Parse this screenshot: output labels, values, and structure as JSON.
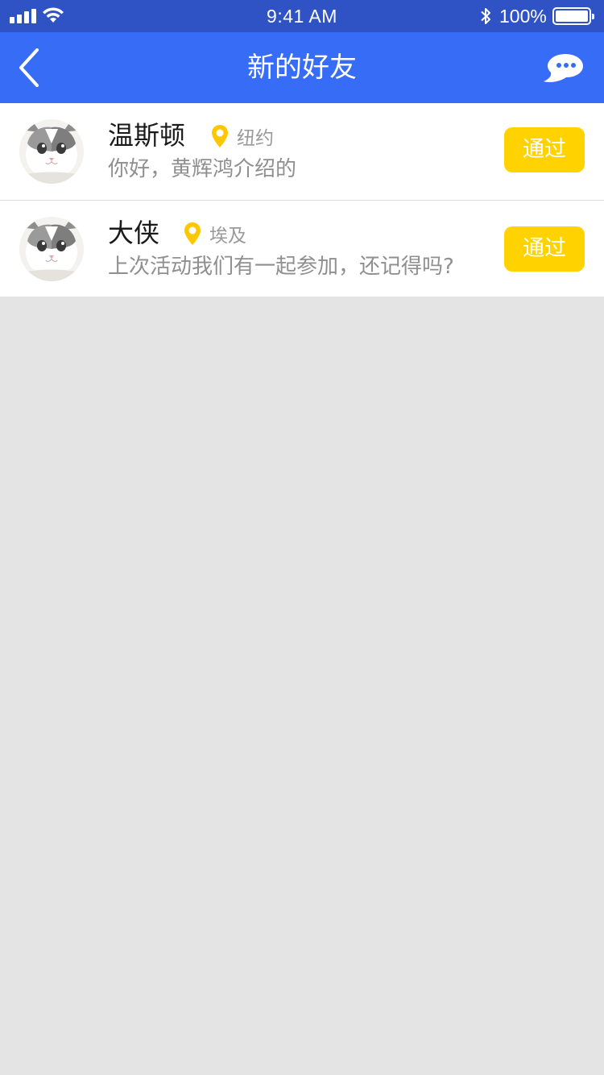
{
  "status_bar": {
    "time": "9:41 AM",
    "battery_percent": "100%",
    "icons": [
      "signal-icon",
      "wifi-icon",
      "bluetooth-icon",
      "battery-icon"
    ]
  },
  "nav": {
    "title": "新的好友",
    "back_icon": "back-chevron-icon",
    "chat_icon": "chat-bubble-icon"
  },
  "colors": {
    "status_bar": "#2f52c4",
    "nav_bar": "#376cf6",
    "accent_yellow": "#ffd200",
    "background": "#e4e4e4"
  },
  "requests": [
    {
      "name": "温斯顿",
      "location": "纽约",
      "message": "你好，黄辉鸿介绍的",
      "button_label": "通过",
      "avatar_icon": "cat-avatar"
    },
    {
      "name": "大侠",
      "location": "埃及",
      "message": "上次活动我们有一起参加，还记得吗?",
      "button_label": "通过",
      "avatar_icon": "cat-avatar"
    }
  ]
}
